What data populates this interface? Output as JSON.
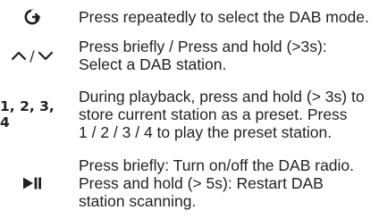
{
  "rows": [
    {
      "icon": "source-mode-icon",
      "lines": [
        "Press repeatedly to select the DAB mode."
      ]
    },
    {
      "icon": "up-down-arrows-icon",
      "symbol_text": "/",
      "lines": [
        "Press briefly / Press and hold (>3s):",
        "Select a DAB station."
      ]
    },
    {
      "symbol_text": "1, 2, 3, 4",
      "lines": [
        "During playback, press and hold (> 3s) to",
        "store current station as a preset. Press",
        "1 / 2 / 3 / 4 to play the preset station."
      ]
    },
    {
      "icon": "play-pause-icon",
      "lines": [
        "Press briefly: Turn on/off the DAB radio.",
        "Press and hold (> 5s): Restart DAB",
        "station scanning."
      ]
    }
  ],
  "colors": {
    "text": "#231f20",
    "background": "#ffffff"
  }
}
